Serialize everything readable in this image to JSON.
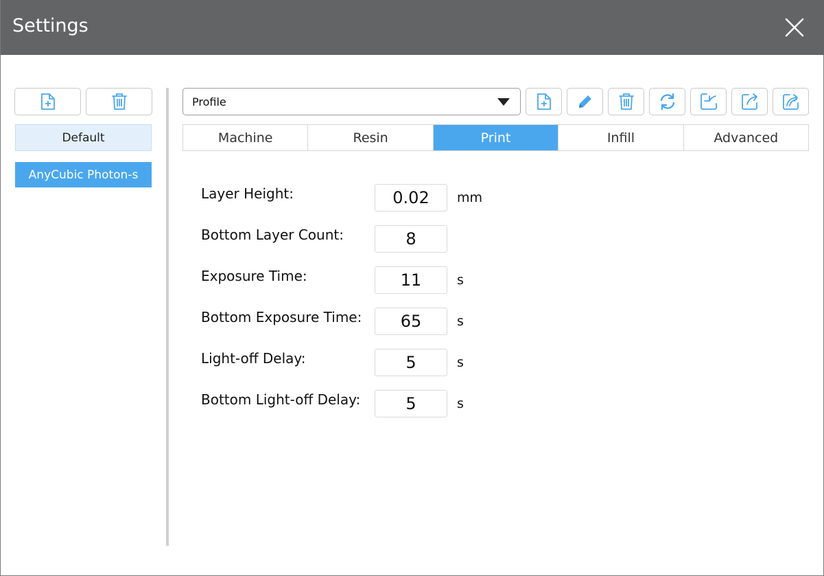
{
  "window": {
    "title": "Settings"
  },
  "colors": {
    "titlebar": "#636466",
    "accent": "#4aa7ee",
    "selected_light": "#e3f0fc",
    "icon": "#4aa7ee"
  },
  "sidebar": {
    "buttons": [
      {
        "name": "add-profile-button",
        "icon": "file-add-icon"
      },
      {
        "name": "delete-profile-button",
        "icon": "trash-icon"
      }
    ],
    "profiles": [
      {
        "label": "Default",
        "state": "hover"
      },
      {
        "label": "AnyCubic Photon-s",
        "state": "selected"
      }
    ]
  },
  "toolbar": {
    "profile_select": {
      "value": "Profile"
    },
    "icons": [
      "file-add-icon",
      "pencil-icon",
      "trash-icon",
      "refresh-icon",
      "import-icon",
      "export-icon",
      "export-all-icon"
    ]
  },
  "tabs": [
    {
      "label": "Machine",
      "active": false
    },
    {
      "label": "Resin",
      "active": false
    },
    {
      "label": "Print",
      "active": true
    },
    {
      "label": "Infill",
      "active": false
    },
    {
      "label": "Advanced",
      "active": false
    }
  ],
  "fields": [
    {
      "label": "Layer Height:",
      "value": "0.02",
      "unit": "mm"
    },
    {
      "label": "Bottom Layer Count:",
      "value": "8",
      "unit": ""
    },
    {
      "label": "Exposure Time:",
      "value": "11",
      "unit": "s"
    },
    {
      "label": "Bottom Exposure Time:",
      "value": "65",
      "unit": "s"
    },
    {
      "label": "Light-off Delay:",
      "value": "5",
      "unit": "s"
    },
    {
      "label": "Bottom Light-off Delay:",
      "value": "5",
      "unit": "s"
    }
  ]
}
